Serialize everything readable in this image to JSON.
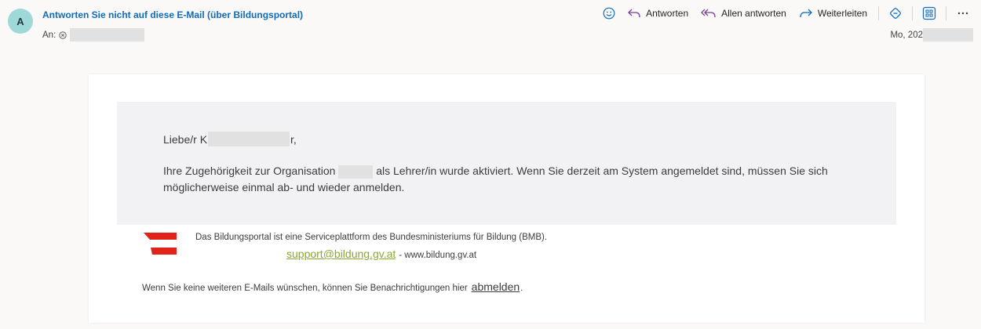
{
  "header": {
    "avatar_initial": "A",
    "sender": "Antworten Sie nicht auf diese E-Mail (über Bildungsportal)",
    "to_label": "An:",
    "date_prefix": "Mo, 202"
  },
  "toolbar": {
    "reply_label": "Antworten",
    "reply_all_label": "Allen antworten",
    "forward_label": "Weiterleiten"
  },
  "email": {
    "greeting_prefix": "Liebe/r K",
    "greeting_suffix": "r,",
    "message_part1": "Ihre Zugehörigkeit zur Organisation",
    "message_part2": "als Lehrer/in wurde aktiviert. Wenn Sie derzeit am System angemeldet sind, müssen Sie sich möglicherweise einmal ab- und wieder anmelden.",
    "footer_text": "Das Bildungsportal ist eine Serviceplattform des Bundesministeriums für Bildung (BMB).",
    "support_email": "support@bildung.gv.at",
    "website": "- www.bildung.gv.at",
    "unsubscribe_prefix": "Wenn Sie keine weiteren E-Mails wünschen, können Sie Benachrichtigungen hier",
    "unsubscribe_link": "abmelden",
    "unsubscribe_suffix": "."
  },
  "colors": {
    "sender": "#0f6cbd",
    "accent_icons": "#0f6cbd",
    "reply_all_icon": "#7b3fa0",
    "support_link": "#8aa832",
    "flag_red": "#e2231a",
    "avatar_bg": "#9fd8d8"
  },
  "icons": [
    "emoji-icon",
    "reply-icon",
    "reply-all-icon",
    "forward-icon",
    "loop-icon",
    "apps-icon",
    "more-icon",
    "remove-recipient-icon"
  ]
}
